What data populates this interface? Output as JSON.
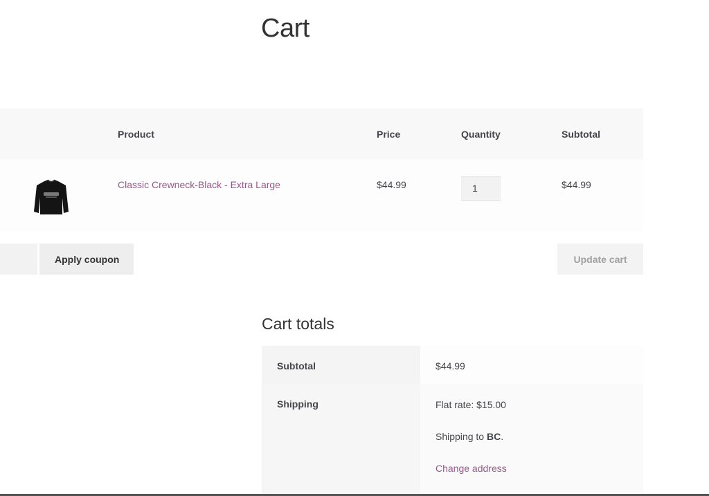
{
  "page": {
    "title": "Cart"
  },
  "cart": {
    "headers": {
      "product": "Product",
      "price": "Price",
      "quantity": "Quantity",
      "subtotal": "Subtotal"
    },
    "items": [
      {
        "name": "Classic Crewneck-Black - Extra Large",
        "price": "$44.99",
        "quantity": "1",
        "subtotal": "$44.99",
        "thumbnail_icon": "black-sweatshirt-thumbnail"
      }
    ],
    "actions": {
      "apply_coupon_label": "Apply coupon",
      "update_cart_label": "Update cart"
    }
  },
  "totals": {
    "title": "Cart totals",
    "subtotal_label": "Subtotal",
    "subtotal_value": "$44.99",
    "shipping_label": "Shipping",
    "shipping_method": "Flat rate: $15.00",
    "shipping_to_prefix": "Shipping to ",
    "shipping_to_region": "BC",
    "shipping_to_suffix": ".",
    "change_address_label": "Change address"
  },
  "colors": {
    "link": "#96588a",
    "header_bg": "#f8f8f8"
  }
}
